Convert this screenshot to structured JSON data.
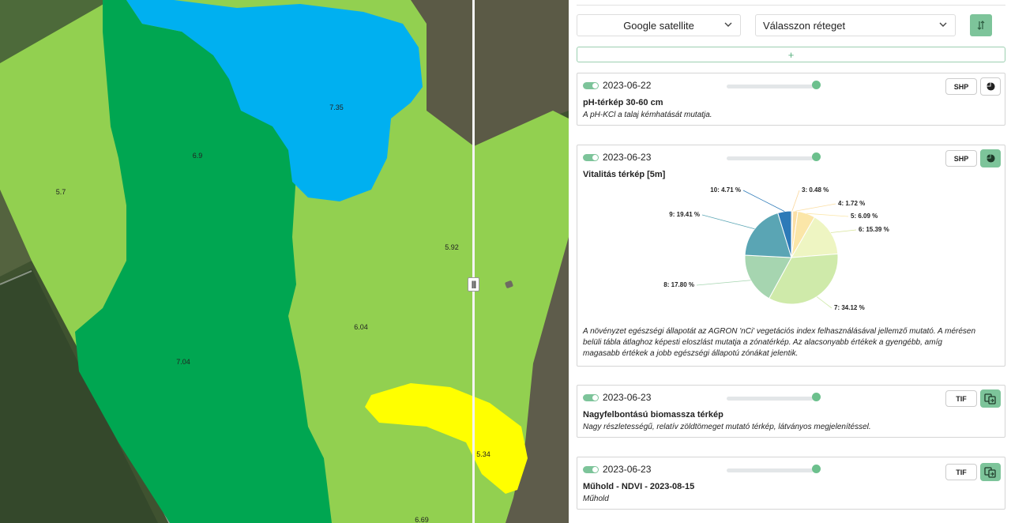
{
  "map": {
    "zone_labels": [
      "7.35",
      "6.9",
      "5.7",
      "5.92",
      "6.04",
      "7.04",
      "5.34",
      "6.69"
    ],
    "swipe_handle": "|||",
    "colors": {
      "zone_low": "#ffff00",
      "zone_mid_low": "#92d050",
      "zone_mid": "#00b050",
      "zone_high": "#00b0f0"
    }
  },
  "toolbar": {
    "basemap": "Google satellite",
    "layer_placeholder": "Válasszon réteget",
    "sort_icon": "sort-icon",
    "add_label": "+"
  },
  "layers": [
    {
      "date": "2023-06-22",
      "format": "SHP",
      "title": "pH-térkép 30-60 cm",
      "description": "A pH-KCl a talaj kémhatását mutatja.",
      "action_icon": "pie-chart-icon",
      "enabled": true
    },
    {
      "date": "2023-06-23",
      "format": "SHP",
      "title": "Vitalitás térkép [5m]",
      "description_lines": [
        "A növényzet egészségi állapotát az AGRON 'nCi' vegetációs index felhasználásával jellemző mutató. A mérésen",
        "belüli tábla átlaghoz képesti eloszlást mutatja a zónatérkép. Az alacsonyabb értékek a gyengébb, amíg",
        "magasabb értékek a jobb egészségi állapotú zónákat jelentik."
      ],
      "action_icon": "pie-chart-icon",
      "enabled": true
    },
    {
      "date": "2023-06-23",
      "format": "TIF",
      "title": "Nagyfelbontású biomassza térkép",
      "description": "Nagy részletességű, relatív zöldtömeget mutató térkép, látványos megjelenítéssel.",
      "action_icon": "compare-maps-icon",
      "enabled": true
    },
    {
      "date": "2023-06-23",
      "format": "TIF",
      "title": "Műhold - NDVI - 2023-08-15",
      "description": "Műhold",
      "action_icon": "compare-maps-icon",
      "enabled": true
    }
  ],
  "chart_data": {
    "type": "pie",
    "slices": [
      {
        "label": "3: 0.48 %",
        "value": 0.48,
        "color": "#fbd79c"
      },
      {
        "label": "4: 1.72 %",
        "value": 1.72,
        "color": "#fbdfa5"
      },
      {
        "label": "5: 6.09 %",
        "value": 6.09,
        "color": "#fbe6a8"
      },
      {
        "label": "6: 15.39 %",
        "value": 15.39,
        "color": "#eef5c2"
      },
      {
        "label": "7: 34.12 %",
        "value": 34.12,
        "color": "#cfeaaa"
      },
      {
        "label": "8: 17.80 %",
        "value": 17.8,
        "color": "#a6d5b0"
      },
      {
        "label": "9: 19.41 %",
        "value": 19.41,
        "color": "#5aa5b4"
      },
      {
        "label": "10: 4.71 %",
        "value": 4.71,
        "color": "#2d7ab8"
      }
    ]
  }
}
